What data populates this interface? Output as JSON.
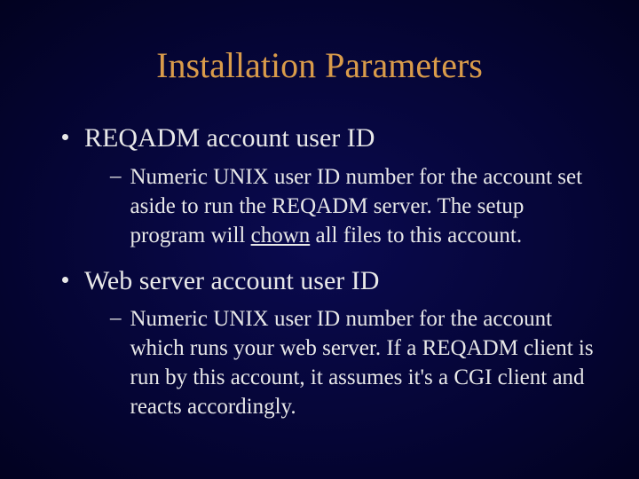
{
  "title": "Installation Parameters",
  "items": [
    {
      "label": "REQADM account user ID",
      "sub": {
        "pre": "Numeric UNIX user ID number for the account set aside to run the REQADM server.  The setup program will ",
        "underlined": "chown",
        "post": " all files to this account."
      }
    },
    {
      "label": "Web server account user ID",
      "sub": {
        "pre": "Numeric UNIX user ID number for the account which runs your web server.  If a REQADM client is run by this account, it assumes it's a CGI client and reacts accordingly.",
        "underlined": "",
        "post": ""
      }
    }
  ]
}
